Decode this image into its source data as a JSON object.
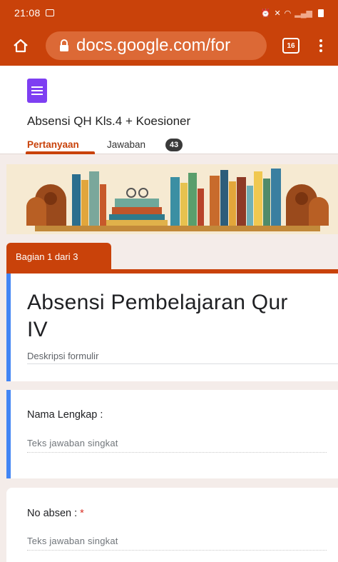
{
  "status_bar": {
    "time": "21:08",
    "icons": [
      "alarm-icon",
      "mute-icon",
      "wifi-icon",
      "signal-icon",
      "battery-icon"
    ]
  },
  "browser": {
    "url": "docs.google.com/for",
    "tab_count": "16"
  },
  "form_header": {
    "doc_title": "Absensi QH Kls.4 + Koesioner",
    "tabs": [
      {
        "label": "Pertanyaan"
      },
      {
        "label": "Jawaban"
      }
    ],
    "responses_count": "43"
  },
  "section": {
    "label": "Bagian 1 dari 3"
  },
  "form": {
    "title_line1": "Absensi Pembelajaran Qur",
    "title_line2": "IV",
    "description_placeholder": "Deskripsi formulir"
  },
  "questions": [
    {
      "label": "Nama Lengkap :",
      "required": false,
      "answer_placeholder": "Teks jawaban singkat"
    },
    {
      "label": "No absen :",
      "required": true,
      "required_mark": "*",
      "answer_placeholder": "Teks jawaban singkat"
    }
  ],
  "colors": {
    "theme": "#c9420a",
    "focus": "#4285f4",
    "forms_purple": "#7e3ff2"
  }
}
